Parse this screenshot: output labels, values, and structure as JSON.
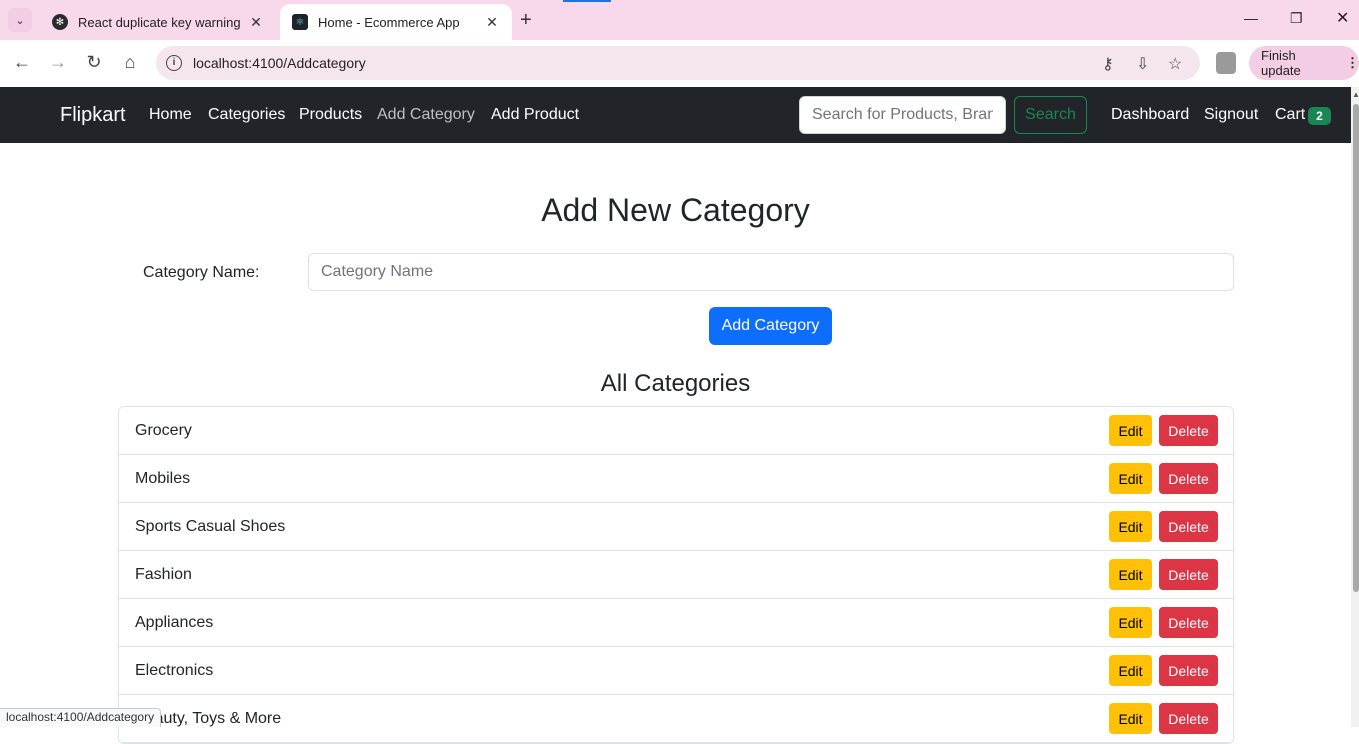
{
  "browser": {
    "tabs": [
      {
        "title": "React duplicate key warning",
        "favicon": "openai-icon",
        "active": false
      },
      {
        "title": "Home - Ecommerce App",
        "favicon": "react-icon",
        "active": true
      }
    ],
    "url": "localhost:4100/Addcategory",
    "finish_update_label": "Finish update",
    "status_text": "localhost:4100/Addcategory"
  },
  "navbar": {
    "brand": "Flipkart",
    "links": [
      "Home",
      "Categories",
      "Products",
      "Add Category",
      "Add Product"
    ],
    "search_placeholder": "Search for Products, Brands and More",
    "search_button": "Search",
    "dashboard": "Dashboard",
    "signout": "Signout",
    "cart_label": "Cart",
    "cart_count": "2"
  },
  "form": {
    "title": "Add New Category",
    "label": "Category Name:",
    "placeholder": "Category Name",
    "submit_label": "Add Category"
  },
  "categories": {
    "title": "All Categories",
    "edit_label": "Edit",
    "delete_label": "Delete",
    "items": [
      "Grocery",
      "Mobiles",
      "Sports Casual Shoes",
      "Fashion",
      "Appliances",
      "Electronics",
      "Beauty, Toys & More"
    ]
  },
  "colors": {
    "navbar_bg": "#212529",
    "primary": "#0d6efd",
    "success": "#198754",
    "warning": "#ffc107",
    "danger": "#dc3545"
  }
}
